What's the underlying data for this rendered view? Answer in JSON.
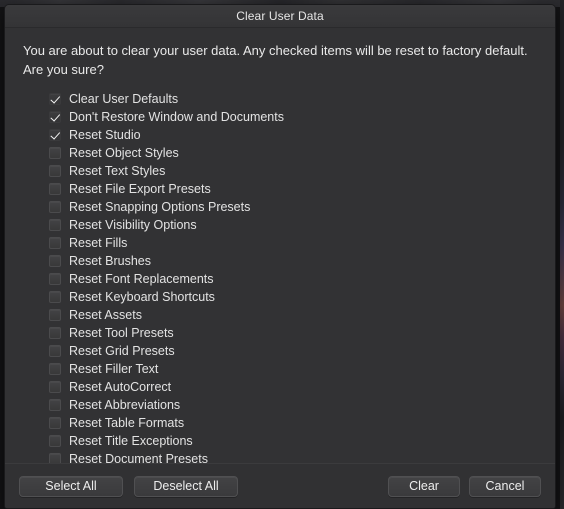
{
  "window": {
    "title": "Clear User Data"
  },
  "message": {
    "text": "You are about to clear your user data. Any checked items will be reset to factory default. Are you sure?"
  },
  "options": [
    {
      "label": "Clear User Defaults",
      "checked": true
    },
    {
      "label": "Don't Restore Window and Documents",
      "checked": true
    },
    {
      "label": "Reset Studio",
      "checked": true
    },
    {
      "label": "Reset Object Styles",
      "checked": false
    },
    {
      "label": "Reset Text Styles",
      "checked": false
    },
    {
      "label": "Reset File Export Presets",
      "checked": false
    },
    {
      "label": "Reset Snapping Options Presets",
      "checked": false
    },
    {
      "label": "Reset Visibility Options",
      "checked": false
    },
    {
      "label": "Reset Fills",
      "checked": false
    },
    {
      "label": "Reset Brushes",
      "checked": false
    },
    {
      "label": "Reset Font Replacements",
      "checked": false
    },
    {
      "label": "Reset Keyboard Shortcuts",
      "checked": false
    },
    {
      "label": "Reset Assets",
      "checked": false
    },
    {
      "label": "Reset Tool Presets",
      "checked": false
    },
    {
      "label": "Reset Grid Presets",
      "checked": false
    },
    {
      "label": "Reset Filler Text",
      "checked": false
    },
    {
      "label": "Reset AutoCorrect",
      "checked": false
    },
    {
      "label": "Reset Abbreviations",
      "checked": false
    },
    {
      "label": "Reset Table Formats",
      "checked": false
    },
    {
      "label": "Reset Title Exceptions",
      "checked": false
    },
    {
      "label": "Reset Document Presets",
      "checked": false
    }
  ],
  "footer": {
    "select_all_label": "Select All",
    "deselect_all_label": "Deselect All",
    "clear_label": "Clear",
    "cancel_label": "Cancel"
  },
  "colors": {
    "window_background": "#323234",
    "titlebar_background": "#3a3a3c",
    "text_primary": "#e9e9e9",
    "button_background": "#434345",
    "button_border": "#505052"
  }
}
